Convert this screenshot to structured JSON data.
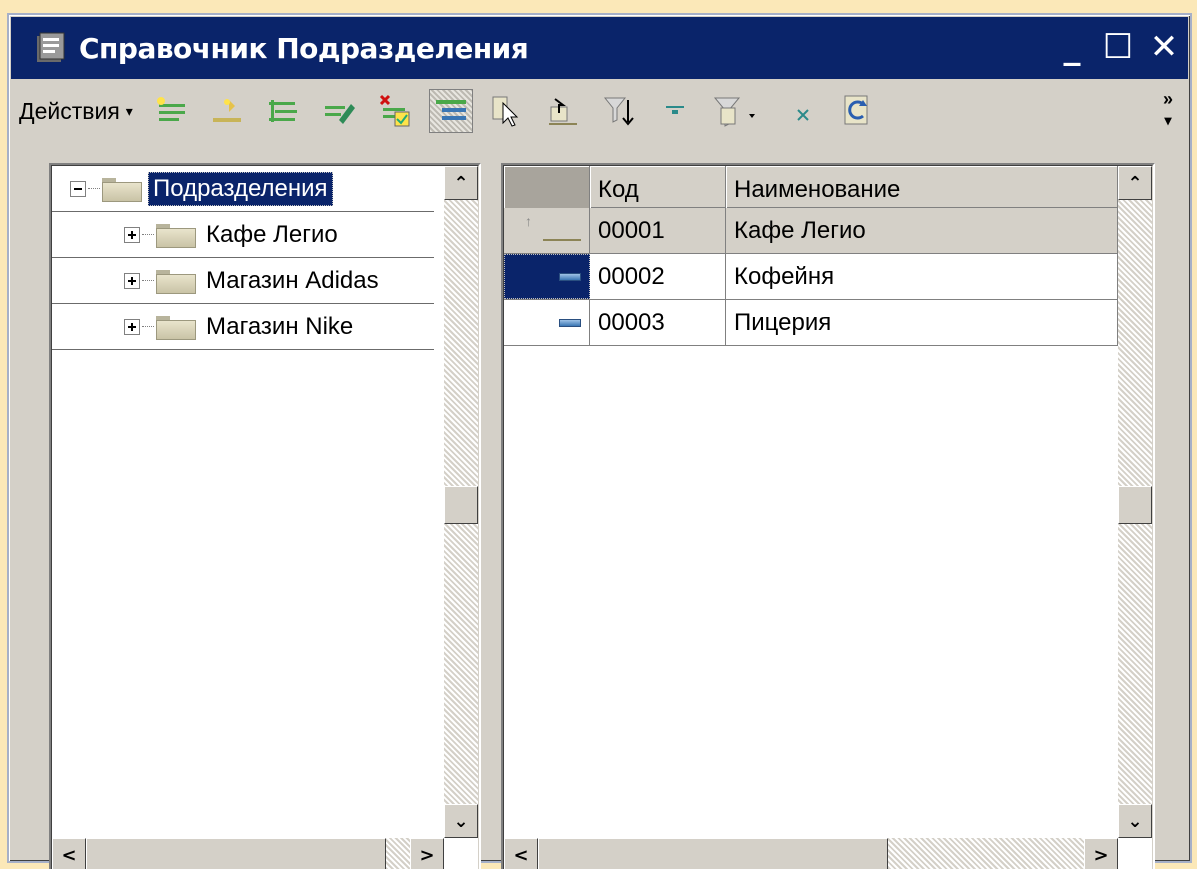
{
  "window": {
    "title": "Справочник Подразделения",
    "controls": {
      "minimize": "_",
      "maximize": "☐",
      "close": "✕"
    },
    "colors": {
      "titlebar": "#0A246A",
      "background": "#D4D0C8",
      "selection": "#0A246A"
    }
  },
  "toolbar": {
    "actions_label": "Действия",
    "actions_caret": "▾",
    "more": "»",
    "buttons": [
      "add-item-icon",
      "copy-item-icon",
      "add-group-icon",
      "edit-item-icon",
      "delete-item-icon",
      "hierarchy-view-icon",
      "select-item-icon",
      "level-up-icon",
      "filter-value-icon",
      "filter-icon",
      "filter-menu-icon",
      "clear-filter-icon",
      "refresh-icon"
    ]
  },
  "tree": {
    "root": {
      "label": "Подразделения",
      "expanded": true,
      "selected": true
    },
    "children": [
      {
        "label": "Кафе Легио"
      },
      {
        "label": "Магазин Adidas"
      },
      {
        "label": "Магазин Nike"
      }
    ]
  },
  "list": {
    "columns": {
      "code": "Код",
      "name": "Наименование"
    },
    "rows": [
      {
        "code": "00001",
        "name": "Кафе Легио",
        "type": "parent-group"
      },
      {
        "code": "00002",
        "name": "Кофейня",
        "type": "item",
        "current": true
      },
      {
        "code": "00003",
        "name": "Пицерия",
        "type": "item"
      }
    ]
  },
  "scroll": {
    "up": "⌃",
    "down": "⌄",
    "left": "<",
    "right": ">"
  }
}
